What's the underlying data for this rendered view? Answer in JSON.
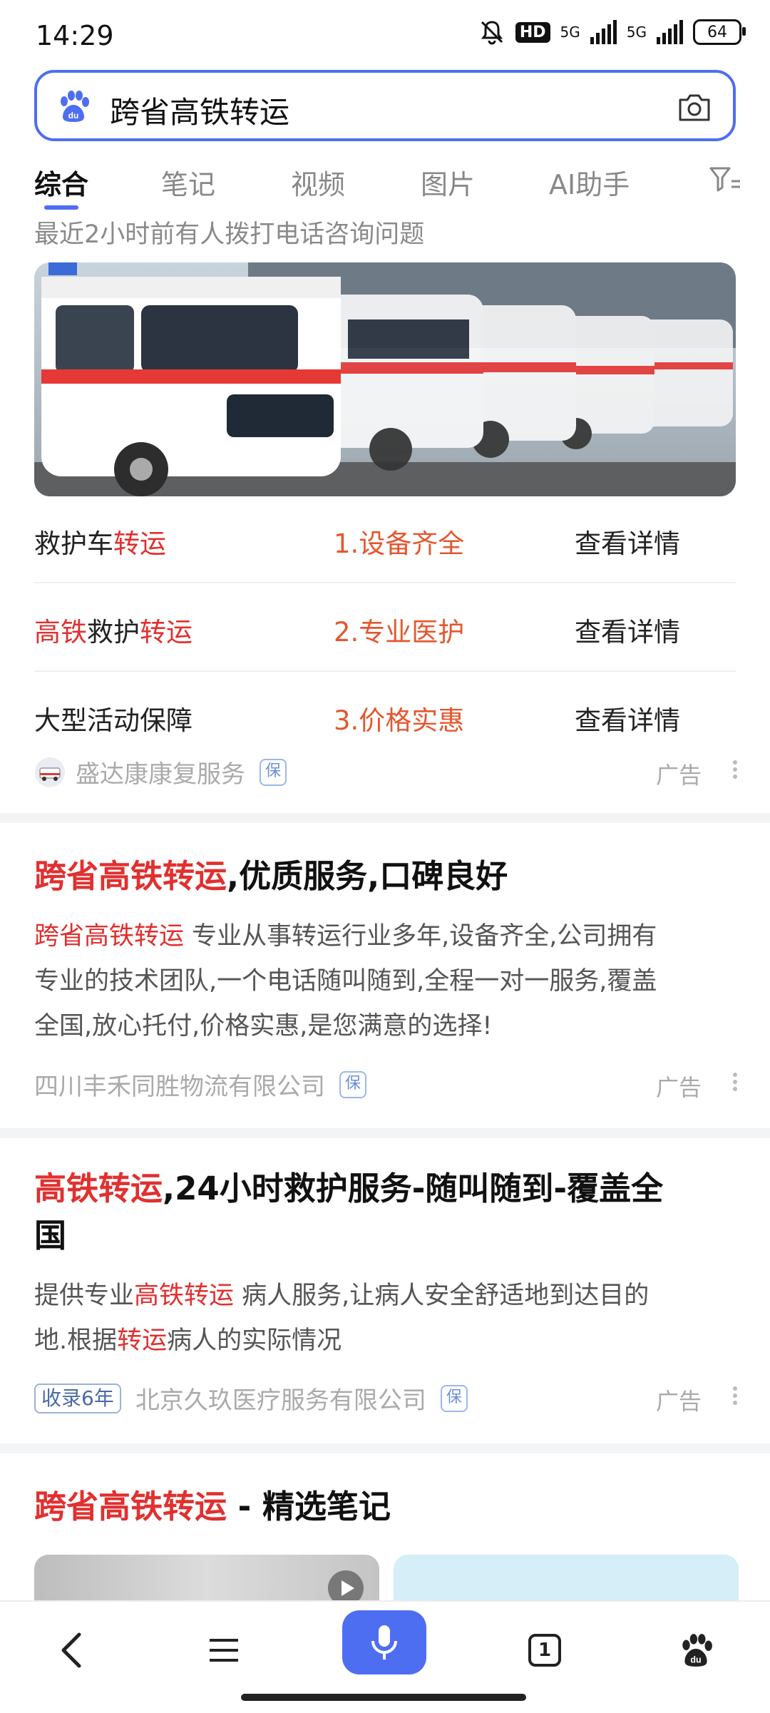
{
  "status_bar": {
    "time": "14:29",
    "hd": "HD",
    "net1": "5G",
    "net2": "5G",
    "battery": "64"
  },
  "search": {
    "query": "跨省高铁转运"
  },
  "tabs": [
    "综合",
    "笔记",
    "视频",
    "图片",
    "AI助手"
  ],
  "recent_note": "最近2小时前有人拨打电话咨询问题",
  "ad1": {
    "rows": [
      {
        "c1": [
          {
            "t": "救护车",
            "red": false
          },
          {
            "t": "转运",
            "red": true
          }
        ],
        "c2": "1.设备齐全",
        "c3": "查看详情"
      },
      {
        "c1": [
          {
            "t": "高铁",
            "red": true
          },
          {
            "t": "救护",
            "red": false
          },
          {
            "t": "转运",
            "red": true
          }
        ],
        "c2": "2.专业医护",
        "c3": "查看详情"
      },
      {
        "c1": [
          {
            "t": "大型活动保障",
            "red": false
          }
        ],
        "c2": "3.价格实惠",
        "c3": "查看详情"
      }
    ],
    "source": "盛达康康复服务",
    "bao": "保",
    "ad_label": "广告"
  },
  "ad2": {
    "title_red": "跨省高铁转运",
    "title_rest": ",优质服务,口碑良好",
    "desc_red": "跨省高铁转运",
    "desc_line1": " 专业从事转运行业多年,设备齐全,公司拥有",
    "desc_line2": "专业的技术团队,一个电话随叫随到,全程一对一服务,覆盖",
    "desc_line3": "全国,放心托付,价格实惠,是您满意的选择!",
    "source": "四川丰禾同胜物流有限公司",
    "bao": "保",
    "ad_label": "广告"
  },
  "ad3": {
    "title_red": "高铁转运",
    "title_rest1": ",24小时救护服务-随叫随到-覆盖全",
    "title_rest2": "国",
    "desc_p1": "提供专业",
    "desc_red1": "高铁转运",
    "desc_p2": " 病人服务,让病人安全舒适地到达目的",
    "desc_p3": "地.根据",
    "desc_red2": "转运",
    "desc_p4": "病人的实际情况",
    "record": "收录6年",
    "source": "北京久玖医疗服务有限公司",
    "bao": "保",
    "ad_label": "广告"
  },
  "notes_section": {
    "title_red": "跨省高铁转运",
    "title_rest": " - 精选笔记"
  },
  "bottom_nav": {
    "tab_count": "1"
  },
  "colors": {
    "accent": "#4e6ef2",
    "keyword_red": "#e1302f",
    "orange": "#e4572e"
  }
}
